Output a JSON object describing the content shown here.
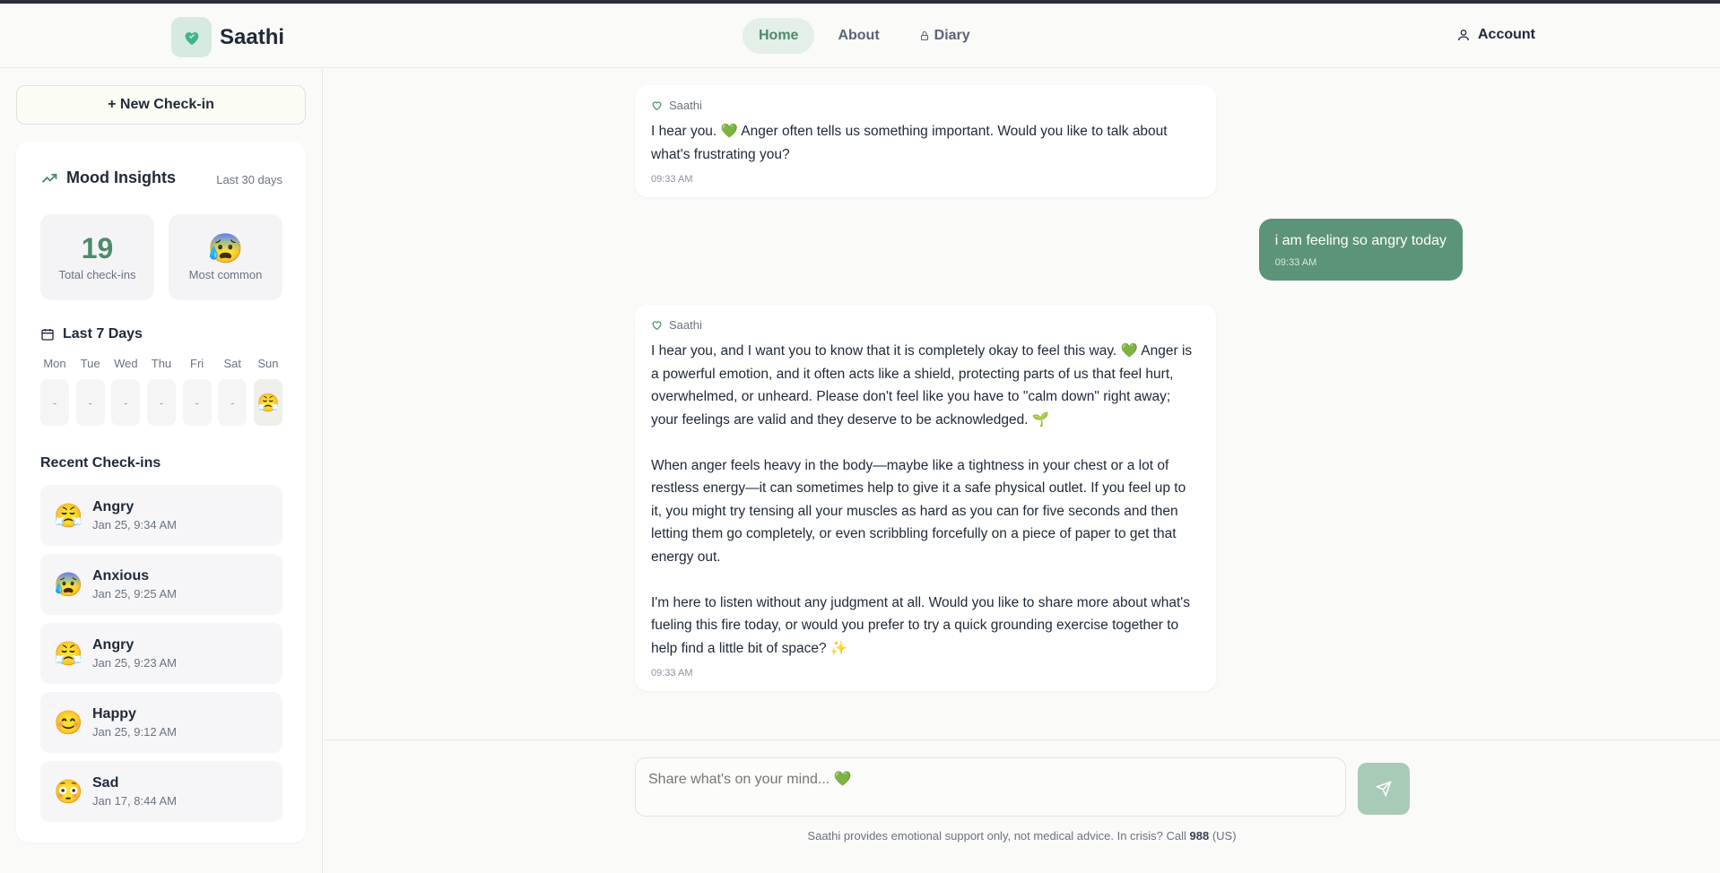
{
  "brand": {
    "name": "Saathi"
  },
  "nav": {
    "items": [
      {
        "label": "Home"
      },
      {
        "label": "About"
      },
      {
        "label": "Diary"
      }
    ]
  },
  "account": {
    "label": "Account"
  },
  "sidebar": {
    "new_checkin": "+ New Check-in",
    "insights": {
      "title": "Mood Insights",
      "range": "Last 30 days",
      "total": {
        "value": "19",
        "label": "Total check-ins"
      },
      "most_common": {
        "emoji": "😰",
        "label": "Most common"
      }
    },
    "week": {
      "title": "Last 7 Days",
      "days": [
        {
          "label": "Mon",
          "value": "-"
        },
        {
          "label": "Tue",
          "value": "-"
        },
        {
          "label": "Wed",
          "value": "-"
        },
        {
          "label": "Thu",
          "value": "-"
        },
        {
          "label": "Fri",
          "value": "-"
        },
        {
          "label": "Sat",
          "value": "-"
        },
        {
          "label": "Sun",
          "value": "😤"
        }
      ]
    },
    "recent": {
      "title": "Recent Check-ins",
      "items": [
        {
          "emoji": "😤",
          "mood": "Angry",
          "time": "Jan 25, 9:34 AM"
        },
        {
          "emoji": "😰",
          "mood": "Anxious",
          "time": "Jan 25, 9:25 AM"
        },
        {
          "emoji": "😤",
          "mood": "Angry",
          "time": "Jan 25, 9:23 AM"
        },
        {
          "emoji": "😊",
          "mood": "Happy",
          "time": "Jan 25, 9:12 AM"
        },
        {
          "emoji": "😳",
          "mood": "Sad",
          "time": "Jan 17, 8:44 AM"
        }
      ]
    }
  },
  "chat": {
    "messages": [
      {
        "sender": "Saathi",
        "text": "I hear you. 💚 Anger often tells us something important. Would you like to talk about what's frustrating you?",
        "time": "09:33 AM"
      },
      {
        "sender": "user",
        "text": "i am feeling so angry today",
        "time": "09:33 AM"
      },
      {
        "sender": "Saathi",
        "text": "I hear you, and I want you to know that it is completely okay to feel this way. 💚 Anger is a powerful emotion, and it often acts like a shield, protecting parts of us that feel hurt, overwhelmed, or unheard. Please don't feel like you have to \"calm down\" right away; your feelings are valid and they deserve to be acknowledged. 🌱\n\nWhen anger feels heavy in the body—maybe like a tightness in your chest or a lot of restless energy—it can sometimes help to give it a safe physical outlet. If you feel up to it, you might try tensing all your muscles as hard as you can for five seconds and then letting them go completely, or even scribbling forcefully on a piece of paper to get that energy out.\n\nI'm here to listen without any judgment at all. Would you like to share more about what's fueling this fire today, or would you prefer to try a quick grounding exercise together to help find a little bit of space? ✨",
        "time": "09:33 AM"
      }
    ]
  },
  "composer": {
    "placeholder": "Share what's on your mind... 💚",
    "disclaimer_pre": "Saathi provides emotional support only, not medical advice. In crisis? Call ",
    "disclaimer_number": "988",
    "disclaimer_post": " (US)"
  },
  "colors": {
    "accent": "#5b9478",
    "accent_light": "#e4efe8",
    "send_button": "#a8cbb7"
  }
}
